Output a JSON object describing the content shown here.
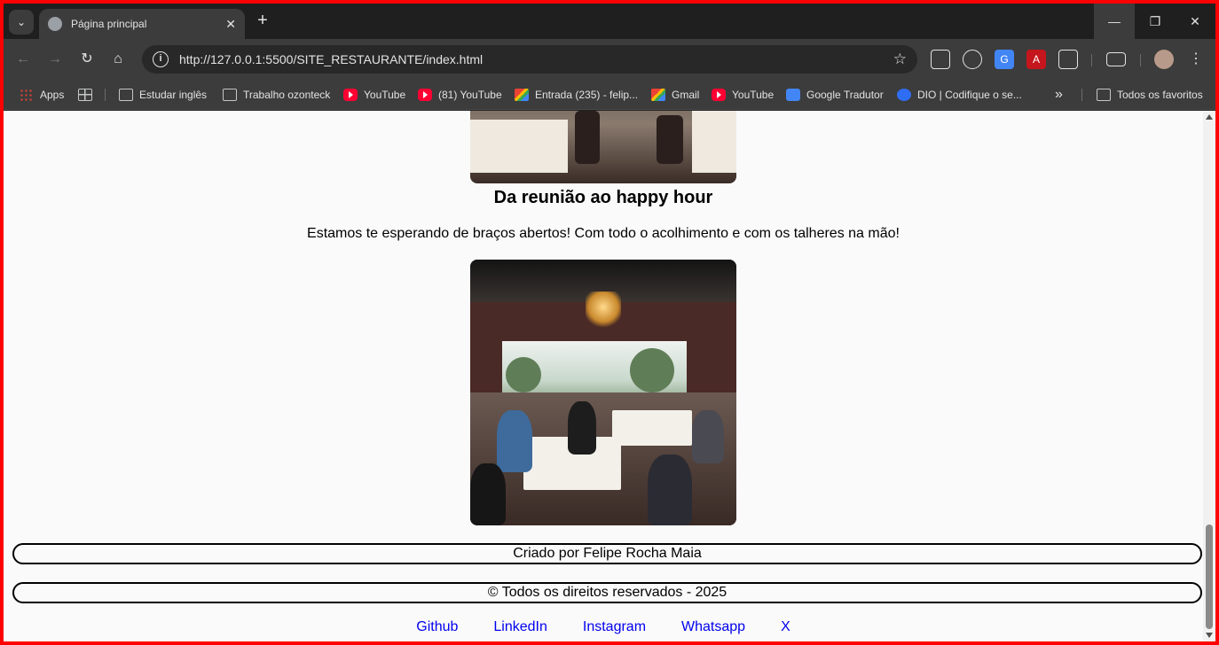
{
  "browser": {
    "tab_title": "Página principal",
    "url": "http://127.0.0.1:5500/SITE_RESTAURANTE/index.html",
    "bookmarks": [
      {
        "label": "Apps",
        "icon": "apps-icon"
      },
      {
        "label": "Estudar inglês",
        "icon": "folder-icon"
      },
      {
        "label": "Trabalho ozonteck",
        "icon": "folder-icon"
      },
      {
        "label": "YouTube",
        "icon": "youtube-icon"
      },
      {
        "label": "(81) YouTube",
        "icon": "youtube-icon"
      },
      {
        "label": "Entrada (235) - felip...",
        "icon": "gmail-icon"
      },
      {
        "label": "Gmail",
        "icon": "gmail-icon"
      },
      {
        "label": "YouTube",
        "icon": "youtube-icon"
      },
      {
        "label": "Google Tradutor",
        "icon": "google-translate-icon"
      },
      {
        "label": "DIO | Codifique o se...",
        "icon": "dio-icon"
      },
      {
        "label": "Todos os favoritos",
        "icon": "folder-icon"
      }
    ],
    "overflow_label": "»"
  },
  "page": {
    "section_title": "Da reunião ao happy hour",
    "section_text": "Estamos te esperando de braços abertos! Com todo o acolhimento e com os talheres na mão!",
    "footer": {
      "credit": "Criado por Felipe Rocha Maia",
      "copyright": "© Todos os direitos reservados - 2025",
      "links": [
        "Github",
        "LinkedIn",
        "Instagram",
        "Whatsapp",
        "X"
      ]
    }
  },
  "colors": {
    "browser_frame": "#202124",
    "page_background": "#fafafa",
    "link": "#0000ee",
    "outer_border": "#ff0000"
  }
}
